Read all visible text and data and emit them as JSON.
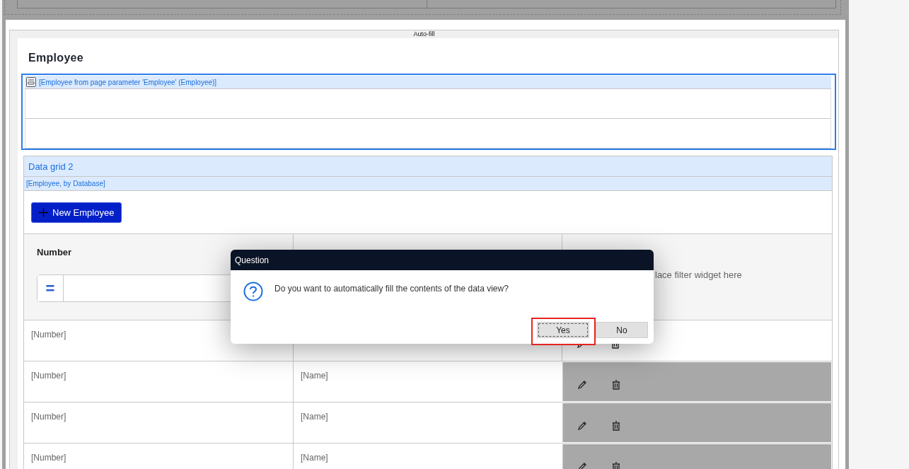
{
  "canvas": {
    "banner": "Auto-fill"
  },
  "page_title": "Employee",
  "data_view": {
    "source": "[Employee from page parameter 'Employee' (Employee)]",
    "selected": true
  },
  "data_grid": {
    "title": "Data grid 2",
    "source": "[Employee, by Database]",
    "new_button": "New Employee",
    "header_cells": [
      {
        "kind": "filter",
        "header": "Number",
        "operator": "="
      },
      {
        "kind": "blank"
      },
      {
        "kind": "hint",
        "hint": "lace filter widget here"
      }
    ],
    "rows": [
      {
        "number": "[Number]",
        "actions_highlighted": false
      },
      {
        "number": "[Number]",
        "name": "[Name]",
        "actions_highlighted": true
      },
      {
        "number": "[Number]",
        "name": "[Name]",
        "actions_highlighted": true
      },
      {
        "number": "[Number]",
        "name": "[Name]",
        "actions_highlighted": true
      }
    ]
  },
  "dialog": {
    "title": "Question",
    "message": "Do you want to automatically fill the contents of the data view?",
    "buttons": [
      {
        "label": "Yes",
        "focused": true,
        "marked": true
      },
      {
        "label": "No",
        "focused": false,
        "marked": false
      }
    ]
  }
}
